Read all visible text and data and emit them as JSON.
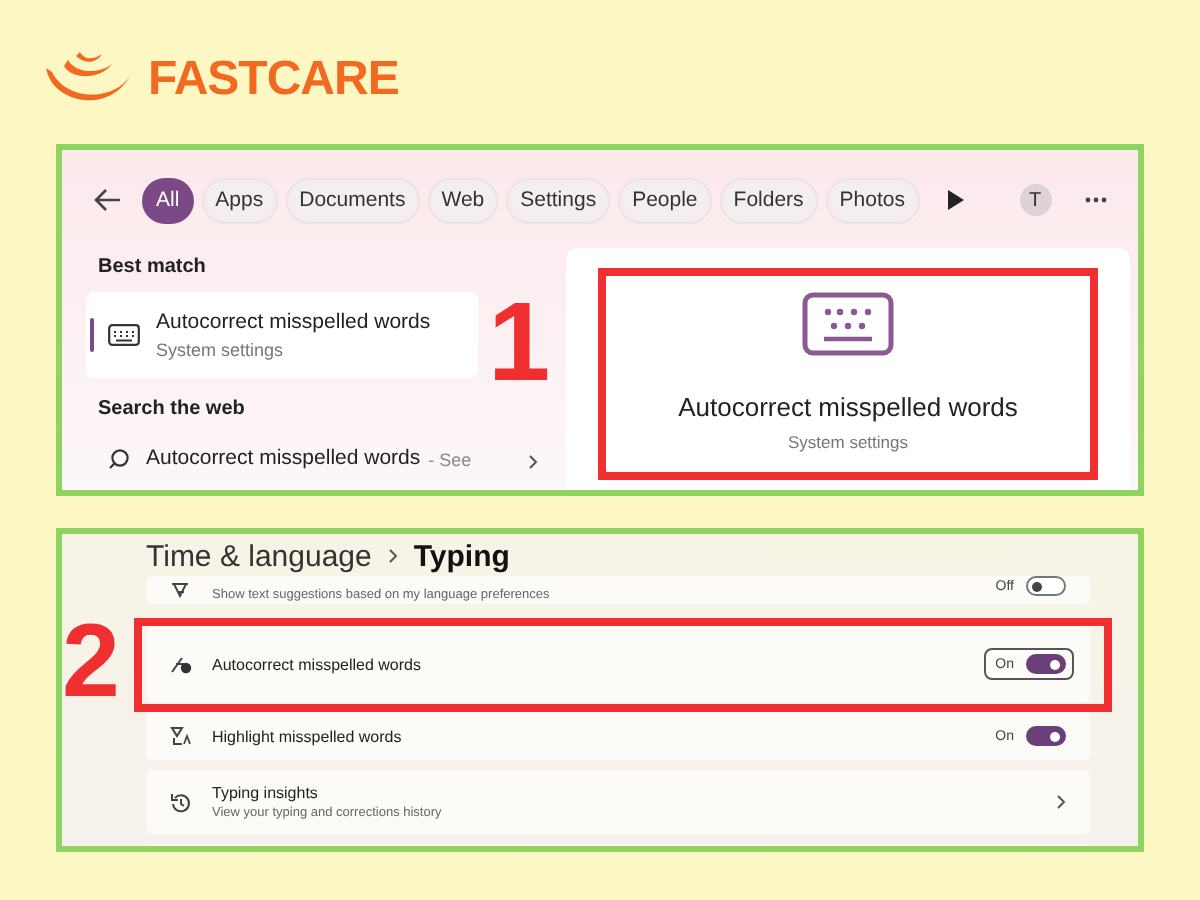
{
  "logo": {
    "text": "FASTCARE"
  },
  "step_1": {
    "marker": "1",
    "filters": [
      {
        "label": "All",
        "selected": true
      },
      {
        "label": "Apps",
        "selected": false
      },
      {
        "label": "Documents",
        "selected": false
      },
      {
        "label": "Web",
        "selected": false
      },
      {
        "label": "Settings",
        "selected": false
      },
      {
        "label": "People",
        "selected": false
      },
      {
        "label": "Folders",
        "selected": false
      },
      {
        "label": "Photos",
        "selected": false
      }
    ],
    "avatar": "T",
    "best_match_heading": "Best match",
    "best_match": {
      "title": "Autocorrect misspelled words",
      "subtitle": "System settings",
      "selected": true
    },
    "web_heading": "Search the web",
    "web_result": {
      "title": "Autocorrect misspelled words",
      "hint": "- See"
    },
    "preview": {
      "title": "Autocorrect misspelled words",
      "subtitle": "System settings",
      "highlighted": true
    }
  },
  "step_2": {
    "marker": "2",
    "breadcrumb": [
      {
        "label": "Time & language"
      },
      {
        "label": "Typing"
      }
    ],
    "settings": [
      {
        "kind": "toggle",
        "subtitle": "Show text suggestions based on my language preferences",
        "state_label": "Off",
        "on": false,
        "focused": false,
        "highlighted": false
      },
      {
        "kind": "toggle",
        "title": "Autocorrect misspelled words",
        "state_label": "On",
        "on": true,
        "focused": true,
        "highlighted": true
      },
      {
        "kind": "toggle",
        "title": "Highlight misspelled words",
        "state_label": "On",
        "on": true,
        "focused": false,
        "highlighted": false
      },
      {
        "kind": "link",
        "title": "Typing insights",
        "subtitle": "View your typing and corrections history",
        "highlighted": false
      },
      {
        "kind": "empty"
      }
    ]
  }
}
